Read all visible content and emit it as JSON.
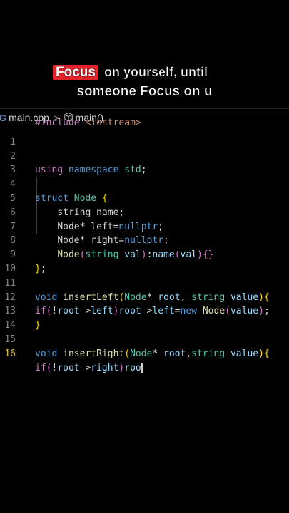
{
  "caption": {
    "highlight": "Focus",
    "line1_rest": "on yourself, until",
    "line2": "someone Focus on u"
  },
  "breadcrumb": {
    "file": "main.cpp",
    "symbol": "main()",
    "file_icon": "cpp-file-icon",
    "symbol_icon": "cube-icon"
  },
  "editor": {
    "active_line": 16,
    "lines": [
      {
        "n": "1",
        "text": "#include <iostream>"
      },
      {
        "n": "2",
        "text": "using namespace std;"
      },
      {
        "n": "3",
        "text": ""
      },
      {
        "n": "4",
        "text": "struct Node {"
      },
      {
        "n": "5",
        "text": "    string name;"
      },
      {
        "n": "6",
        "text": "    Node* left=nullptr;"
      },
      {
        "n": "7",
        "text": "    Node* right=nullptr;"
      },
      {
        "n": "8",
        "text": "    Node(string val):name(val){}"
      },
      {
        "n": "9",
        "text": "};"
      },
      {
        "n": "10",
        "text": ""
      },
      {
        "n": "11",
        "text": "void insertLeft(Node* root, string value){"
      },
      {
        "n": "12",
        "text": "if(!root->left)root->left=new Node(value);"
      },
      {
        "n": "13",
        "text": "}"
      },
      {
        "n": "14",
        "text": ""
      },
      {
        "n": "15",
        "text": "void insertRight(Node* root,string value){"
      },
      {
        "n": "16",
        "text": "if(!root->right)roo"
      }
    ]
  },
  "colors": {
    "background": "#000000",
    "highlight_red": "#e3242b",
    "keyword_blue": "#569cd6",
    "type_teal": "#4ec9b0",
    "function_yellow": "#dcdcaa",
    "active_line_number": "#e8c547"
  }
}
